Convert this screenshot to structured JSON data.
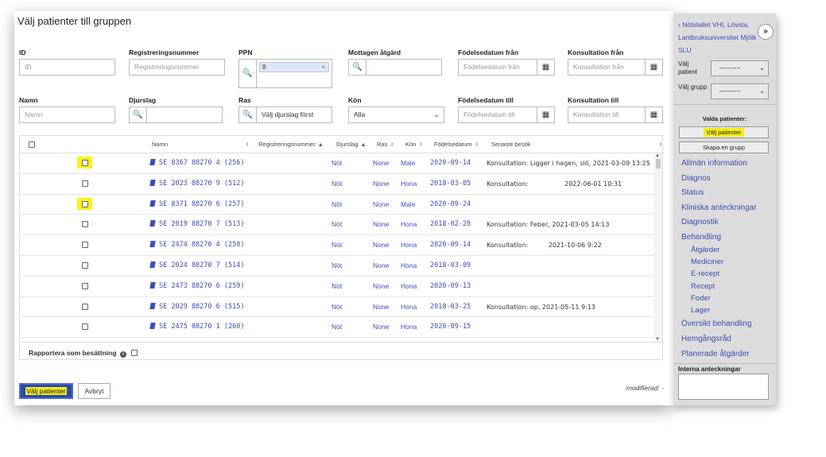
{
  "modal": {
    "title": "Välj patienter till gruppen",
    "filters": {
      "id": {
        "label": "ID",
        "placeholder": "ID"
      },
      "regnr": {
        "label": "Registreringsnummer",
        "placeholder": "Registreringsnummer"
      },
      "ppn": {
        "label": "PPN",
        "tag_value": "8"
      },
      "mottagen": {
        "label": "Mottagen åtgärd",
        "value": ""
      },
      "fodelse_fran": {
        "label": "Födelsedatum från",
        "placeholder": "Födelsedatum från"
      },
      "konsult_fran": {
        "label": "Konsultation från",
        "placeholder": "Konsultation från"
      },
      "namn": {
        "label": "Namn",
        "placeholder": "Namn"
      },
      "djurslag": {
        "label": "Djurslag",
        "value": ""
      },
      "ras": {
        "label": "Ras",
        "placeholder": "Välj djurslag först"
      },
      "kon": {
        "label": "Kön",
        "value": "Alla"
      },
      "fodelse_till": {
        "label": "Födelsedatum till",
        "placeholder": "Födelsedatum till"
      },
      "konsult_till": {
        "label": "Konsultation till",
        "placeholder": "Konsultation till"
      }
    },
    "table": {
      "columns": {
        "namn": "Namn",
        "regnr": "Registreringsnummer",
        "djurslag": "Djurslag",
        "ras": "Ras",
        "kon": "Kön",
        "fodelsedatum": "Födelsedatum",
        "senaste": "Senaste besök"
      },
      "rows": [
        {
          "name": "SE 8367 88270 4 (256)",
          "species": "Nöt",
          "breed": "None",
          "sex": "Male",
          "birth": "2020-09-14",
          "visit": "Konsultation: Ligger i hagen, slö, 2021-03-09 13:25",
          "highlighted": true
        },
        {
          "name": "SE 2023 88270 9 (512)",
          "species": "Nöt",
          "breed": "None",
          "sex": "Hona",
          "birth": "2018-03-05",
          "visit": "Konsultation:                  2022-06-01 10:31",
          "highlighted": false
        },
        {
          "name": "SE 8371 88270 6 (257)",
          "species": "Nöt",
          "breed": "None",
          "sex": "Male",
          "birth": "2020-09-24",
          "visit": "",
          "highlighted": true
        },
        {
          "name": "SE 2019 88270 7 (513)",
          "species": "Nöt",
          "breed": "None",
          "sex": "Hona",
          "birth": "2018-02-28",
          "visit": "Konsultation: Feber, 2021-03-05 14:13",
          "highlighted": false
        },
        {
          "name": "SE 2474 88270 4 (258)",
          "species": "Nöt",
          "breed": "None",
          "sex": "Hona",
          "birth": "2020-09-14",
          "visit": "Konsultation:          2021-10-06 9:22",
          "highlighted": false
        },
        {
          "name": "SE 2024 88270 7 (514)",
          "species": "Nöt",
          "breed": "None",
          "sex": "Hona",
          "birth": "2018-03-09",
          "visit": "",
          "highlighted": false
        },
        {
          "name": "SE 2473 88270 6 (259)",
          "species": "Nöt",
          "breed": "None",
          "sex": "Hona",
          "birth": "2020-09-13",
          "visit": "",
          "highlighted": false
        },
        {
          "name": "SE 2029 88270 6 (515)",
          "species": "Nöt",
          "breed": "None",
          "sex": "Hona",
          "birth": "2018-03-25",
          "visit": "Konsultation: op, 2021-05-11 9:13",
          "highlighted": false
        },
        {
          "name": "SE 2475 88270 1 (260)",
          "species": "Nöt",
          "breed": "None",
          "sex": "Hona",
          "birth": "2020-09-15",
          "visit": "",
          "highlighted": false
        }
      ],
      "report_label": "Rapportera som besättning"
    },
    "buttons": {
      "select": "Välj patienter",
      "cancel": "Avbryt"
    },
    "modified": "modifierad: -"
  },
  "sidebar": {
    "header_lines": [
      "Nötstallet VHI, Lövsta,",
      "Lantbruksuniversitet Mjölk",
      "SLU"
    ],
    "valj_patient_label": "Välj patient",
    "valj_patient_value": "----------",
    "valj_grupp_label": "Välj grupp",
    "valj_grupp_value": "----------",
    "valda_label": "Valda patienter:",
    "btn_valj": "Välj patienter",
    "btn_skapa": "Skapa en grupp",
    "nav": [
      "Allmän information",
      "Diagnos",
      "Status",
      "Kliniska anteckningar",
      "Diagnostik",
      "Behandling"
    ],
    "nav_sub": [
      "Åtgärder",
      "Mediciner",
      "E-recept",
      "Recept",
      "Foder",
      "Lager"
    ],
    "nav_after": [
      "Översikt behandling",
      "Hemgångsråd",
      "Planerade åtgärder"
    ],
    "notes_label": "Interna anteckningar"
  }
}
